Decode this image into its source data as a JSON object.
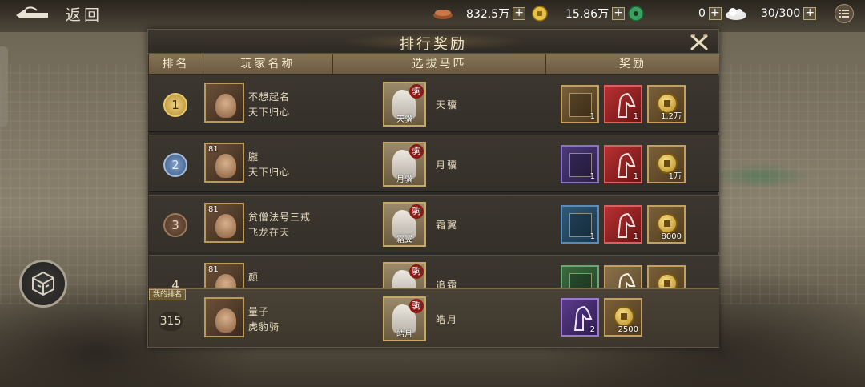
{
  "topbar": {
    "back_label": "返回",
    "resources": [
      {
        "icon": "copper-icon",
        "value": "832.5万"
      },
      {
        "icon": "gold-coin-icon",
        "value": "15.86万"
      },
      {
        "icon": "jade-icon",
        "value": "0"
      },
      {
        "icon": "stamina-icon",
        "value": "30/300"
      }
    ]
  },
  "dialog": {
    "title": "排行奖励",
    "headers": [
      "排名",
      "玩家名称",
      "选拔马匹",
      "奖励"
    ],
    "rows": [
      {
        "rank": "1",
        "level": "",
        "name": "不想起名",
        "guild": "天下归心",
        "horse_label": "天骥",
        "horse_name": "天骥",
        "horse_badge": "驹",
        "rewards": [
          {
            "type": "gold-card",
            "qty": "1"
          },
          {
            "type": "red-horse",
            "qty": "1"
          },
          {
            "type": "coin",
            "qty": "1.2万"
          }
        ]
      },
      {
        "rank": "2",
        "level": "81",
        "name": "朧",
        "guild": "天下归心",
        "horse_label": "月骥",
        "horse_name": "月骥",
        "horse_badge": "驹",
        "rewards": [
          {
            "type": "purple-card",
            "qty": "1"
          },
          {
            "type": "red-horse",
            "qty": "1"
          },
          {
            "type": "coin",
            "qty": "1万"
          }
        ]
      },
      {
        "rank": "3",
        "level": "81",
        "name": "贫僧法号三戒",
        "guild": "飞龙在天",
        "horse_label": "霜翼",
        "horse_name": "霜翼",
        "horse_badge": "驹",
        "rewards": [
          {
            "type": "blue-card",
            "qty": "1"
          },
          {
            "type": "red-horse",
            "qty": "1"
          },
          {
            "type": "coin",
            "qty": "8000"
          }
        ]
      },
      {
        "rank": "4",
        "level": "81",
        "name": "颜",
        "guild": "",
        "horse_label": "",
        "horse_name": "追霜",
        "horse_badge": "驹",
        "rewards": [
          {
            "type": "green-card",
            "qty": ""
          },
          {
            "type": "gold-horse",
            "qty": ""
          },
          {
            "type": "coin",
            "qty": ""
          }
        ]
      }
    ],
    "my_rank": {
      "tag": "我的排名",
      "rank": "315",
      "name": "量子",
      "guild": "虎豹骑",
      "horse_label": "皓月",
      "horse_name": "皓月",
      "horse_badge": "驹",
      "rewards": [
        {
          "type": "purple-horse",
          "qty": "2"
        },
        {
          "type": "coin",
          "qty": "2500"
        }
      ]
    }
  }
}
